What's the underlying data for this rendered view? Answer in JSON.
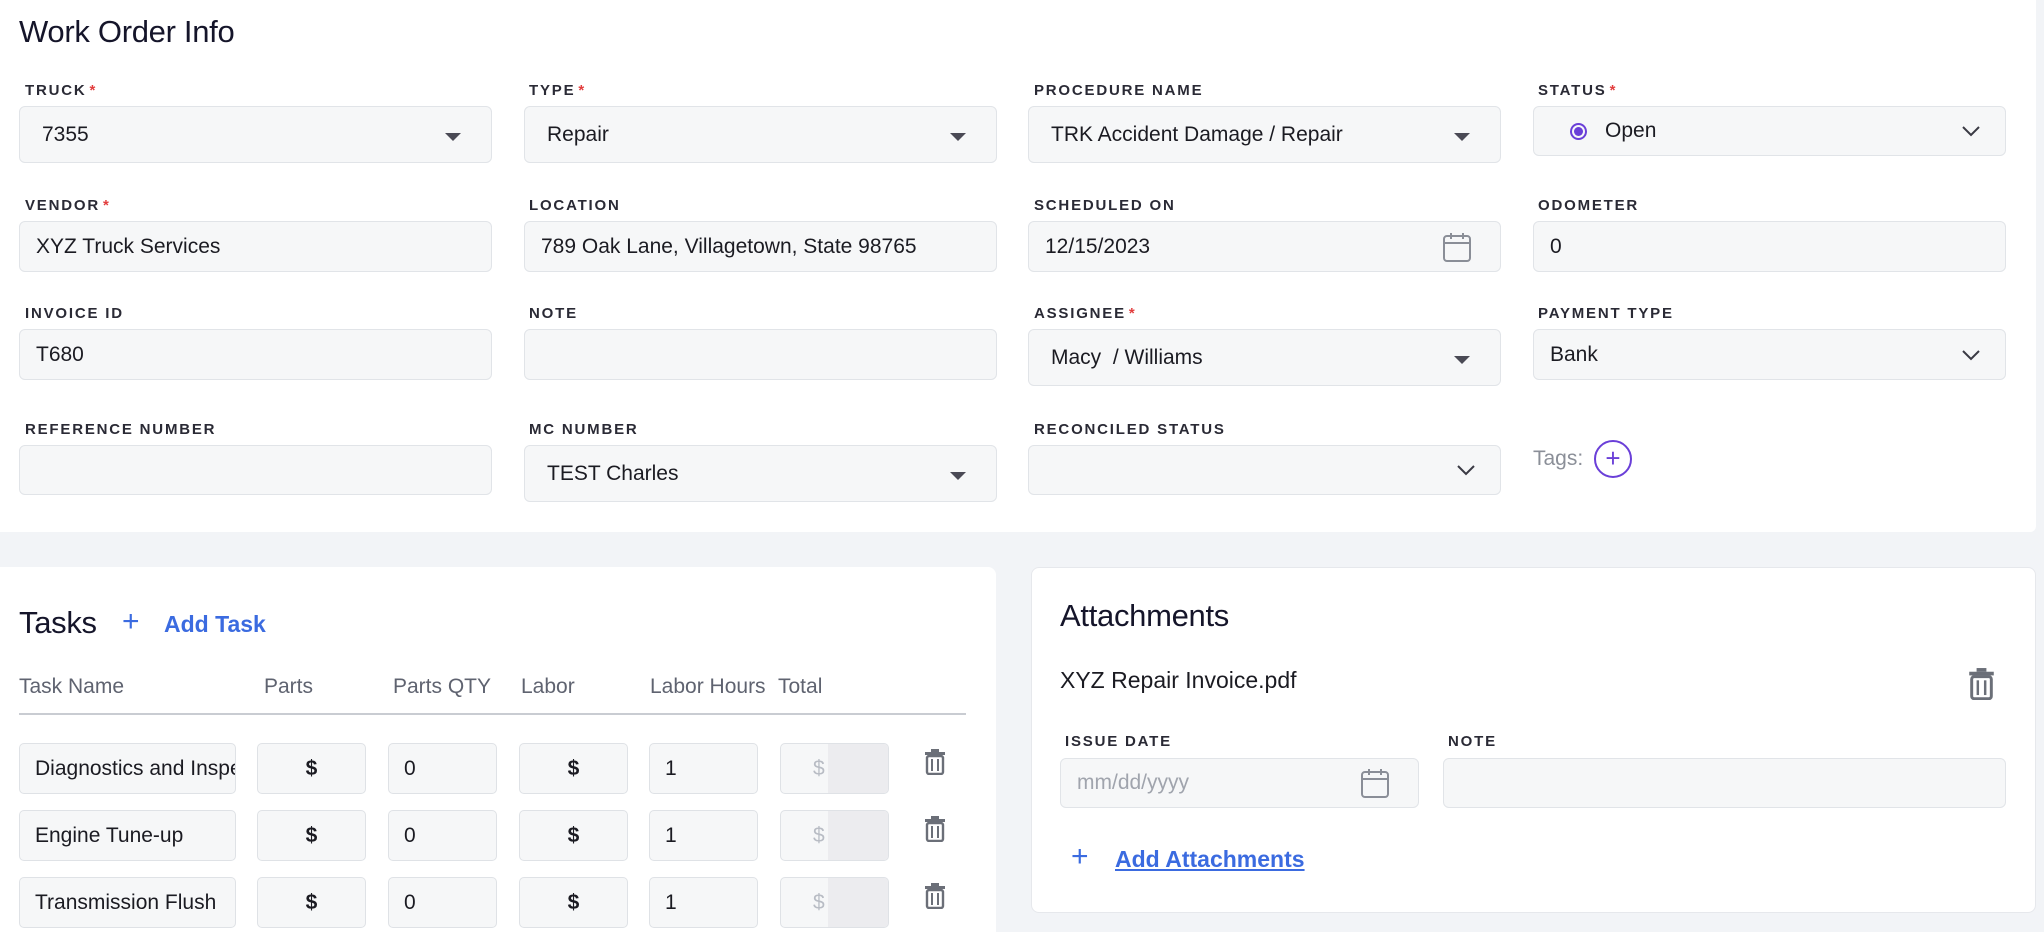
{
  "work_order": {
    "title": "Work Order Info",
    "fields": {
      "truck": {
        "label": "TRUCK",
        "value": "7355"
      },
      "type": {
        "label": "TYPE",
        "value": "Repair"
      },
      "procedure": {
        "label": "PROCEDURE NAME",
        "value": "TRK Accident Damage / Repair"
      },
      "status": {
        "label": "STATUS",
        "value": "Open"
      },
      "vendor": {
        "label": "VENDOR",
        "value": "XYZ Truck Services"
      },
      "location": {
        "label": "LOCATION",
        "value": "789 Oak Lane, Villagetown, State 98765"
      },
      "scheduled_on": {
        "label": "SCHEDULED ON",
        "value": "12/15/2023"
      },
      "odometer": {
        "label": "ODOMETER",
        "value": "0"
      },
      "invoice_id": {
        "label": "INVOICE ID",
        "value": "T680"
      },
      "note": {
        "label": "NOTE",
        "value": ""
      },
      "assignee": {
        "label": "ASSIGNEE",
        "value": "Macy  / Williams"
      },
      "payment_type": {
        "label": "PAYMENT TYPE",
        "value": "Bank"
      },
      "reference_number": {
        "label": "REFERENCE NUMBER",
        "value": ""
      },
      "mc_number": {
        "label": "MC NUMBER",
        "value": "TEST Charles"
      },
      "reconciled_status": {
        "label": "RECONCILED STATUS",
        "value": ""
      }
    },
    "required_mark": "*",
    "tags_label": "Tags:",
    "tags_add": "+"
  },
  "tasks": {
    "title": "Tasks",
    "add_label": "Add Task",
    "plus": "+",
    "columns": [
      "Task Name",
      "Parts",
      "Parts QTY",
      "Labor",
      "Labor Hours",
      "Total"
    ],
    "currency": "$",
    "rows": [
      {
        "name": "Diagnostics and Inspection",
        "parts_qty": "0",
        "labor_hours": "1"
      },
      {
        "name": "Engine Tune-up",
        "parts_qty": "0",
        "labor_hours": "1"
      },
      {
        "name": "Transmission Flush",
        "parts_qty": "0",
        "labor_hours": "1"
      }
    ]
  },
  "attachments": {
    "title": "Attachments",
    "file_name": "XYZ Repair Invoice.pdf",
    "issue_date_label": "ISSUE DATE",
    "issue_date_placeholder": "mm/dd/yyyy",
    "note_label": "NOTE",
    "note_value": "",
    "add_label": "Add Attachments",
    "plus": "+"
  },
  "icons": {
    "dropdown": "caret-down-icon",
    "chevron": "chevron-down-icon",
    "calendar": "calendar-icon",
    "trash": "trash-icon",
    "add": "plus-circle-icon"
  },
  "colors": {
    "accent": "#6a3fd8",
    "link": "#3b6be0",
    "required": "#e23d3d"
  }
}
